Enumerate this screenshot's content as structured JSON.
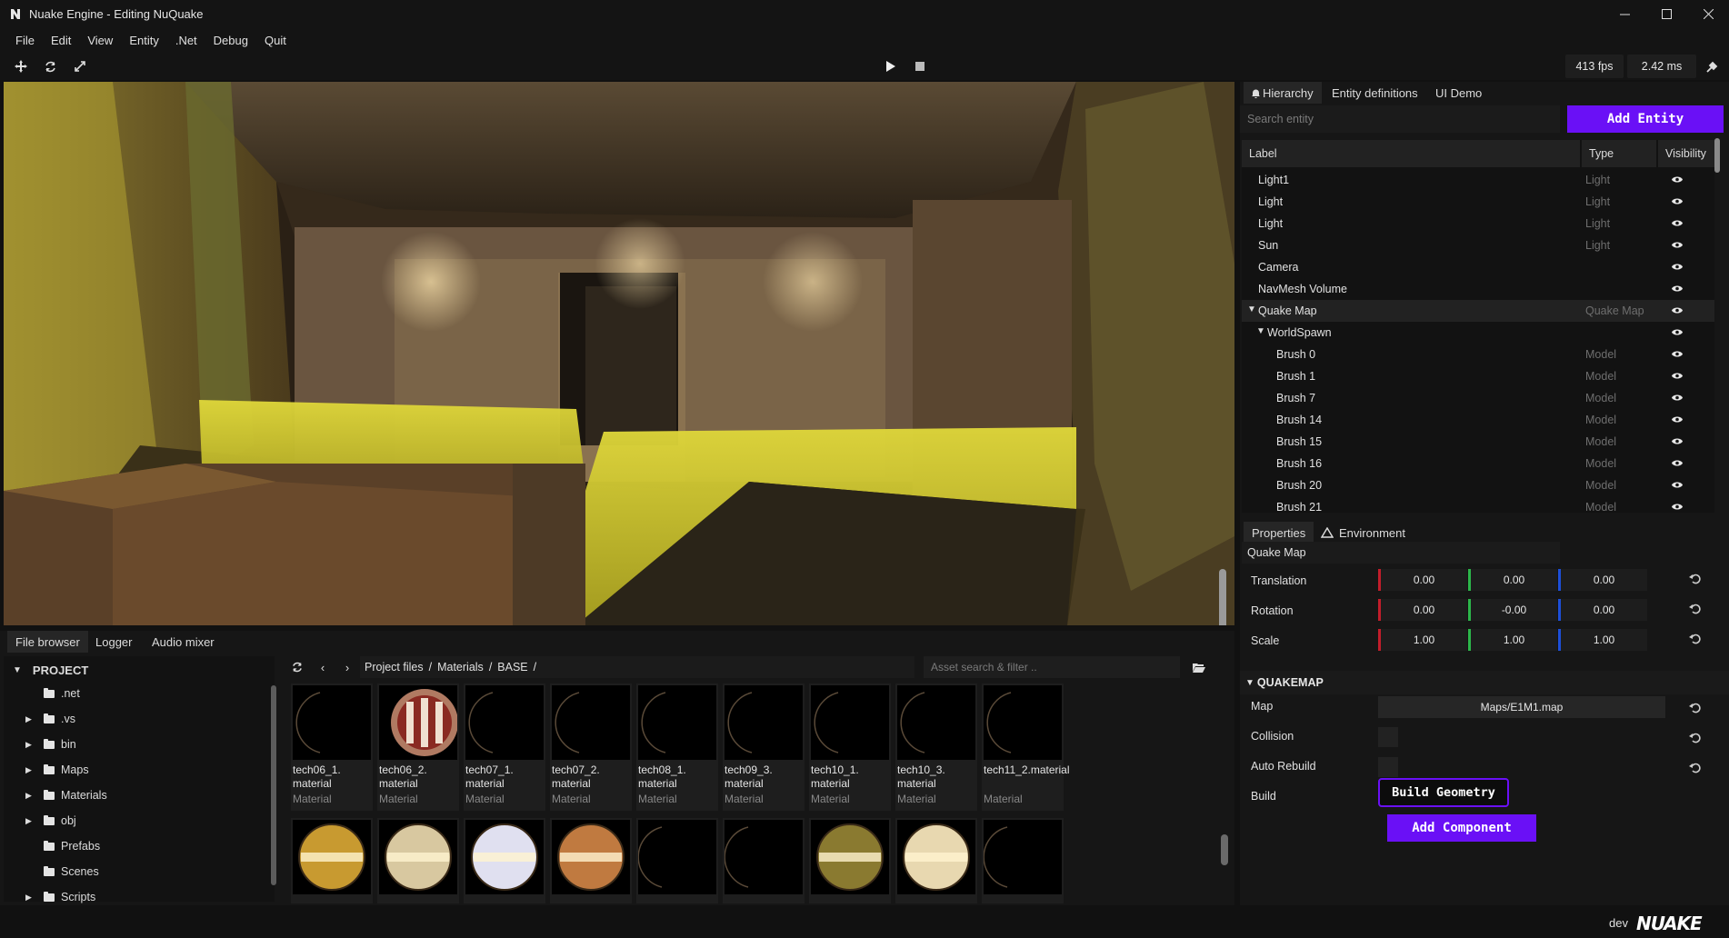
{
  "window": {
    "title": "Nuake Engine - Editing NuQuake"
  },
  "menu": {
    "items": [
      "File",
      "Edit",
      "View",
      "Entity",
      ".Net",
      "Debug",
      "Quit"
    ]
  },
  "toolbar": {
    "fps": "413 fps",
    "frame_time": "2.42 ms"
  },
  "bottom_tabs": [
    "File browser",
    "Logger",
    "Audio mixer"
  ],
  "project_tree": {
    "root": "PROJECT",
    "items": [
      ".net",
      ".vs",
      "bin",
      "Maps",
      "Materials",
      "obj",
      "Prefabs",
      "Scenes",
      "Scripts"
    ]
  },
  "file_browser": {
    "path": [
      "Project files",
      "/",
      "Materials",
      "/",
      "BASE",
      "/"
    ],
    "search_placeholder": "Asset search & filter ..",
    "assets": [
      {
        "name": "tech06_1.\nmaterial",
        "type": "Material",
        "thumb": "dark"
      },
      {
        "name": "tech06_2.\nmaterial",
        "type": "Material",
        "thumb": "red"
      },
      {
        "name": "tech07_1.\nmaterial",
        "type": "Material",
        "thumb": "dark"
      },
      {
        "name": "tech07_2.\nmaterial",
        "type": "Material",
        "thumb": "dark"
      },
      {
        "name": "tech08_1.\nmaterial",
        "type": "Material",
        "thumb": "dark"
      },
      {
        "name": "tech09_3.\nmaterial",
        "type": "Material",
        "thumb": "dark"
      },
      {
        "name": "tech10_1.\nmaterial",
        "type": "Material",
        "thumb": "dark"
      },
      {
        "name": "tech10_3.\nmaterial",
        "type": "Material",
        "thumb": "dark"
      },
      {
        "name": "tech11_2.material",
        "type": "Material",
        "thumb": "dark"
      }
    ]
  },
  "right_tabs": [
    "Hierarchy",
    "Entity definitions",
    "UI Demo"
  ],
  "hierarchy": {
    "search_placeholder": "Search entity",
    "add_entity": "Add Entity",
    "columns": [
      "Label",
      "Type",
      "Visibility"
    ],
    "rows": [
      {
        "label": "Light1",
        "type": "Light",
        "indent": 0,
        "arrow": ""
      },
      {
        "label": "Light",
        "type": "Light",
        "indent": 0,
        "arrow": ""
      },
      {
        "label": "Light",
        "type": "Light",
        "indent": 0,
        "arrow": ""
      },
      {
        "label": "Sun",
        "type": "Light",
        "indent": 0,
        "arrow": ""
      },
      {
        "label": "Camera",
        "type": "",
        "indent": 0,
        "arrow": ""
      },
      {
        "label": "NavMesh Volume",
        "type": "",
        "indent": 0,
        "arrow": ""
      },
      {
        "label": "Quake Map",
        "type": "Quake Map",
        "indent": 0,
        "arrow": "▼",
        "selected": true
      },
      {
        "label": "WorldSpawn",
        "type": "",
        "indent": 1,
        "arrow": "▼"
      },
      {
        "label": "Brush 0",
        "type": "Model",
        "indent": 2,
        "arrow": ""
      },
      {
        "label": "Brush 1",
        "type": "Model",
        "indent": 2,
        "arrow": ""
      },
      {
        "label": "Brush 7",
        "type": "Model",
        "indent": 2,
        "arrow": ""
      },
      {
        "label": "Brush 14",
        "type": "Model",
        "indent": 2,
        "arrow": ""
      },
      {
        "label": "Brush 15",
        "type": "Model",
        "indent": 2,
        "arrow": ""
      },
      {
        "label": "Brush 16",
        "type": "Model",
        "indent": 2,
        "arrow": ""
      },
      {
        "label": "Brush 20",
        "type": "Model",
        "indent": 2,
        "arrow": ""
      },
      {
        "label": "Brush 21",
        "type": "Model",
        "indent": 2,
        "arrow": ""
      }
    ]
  },
  "properties": {
    "tabs": [
      "Properties",
      "Environment"
    ],
    "entity_name": "Quake Map",
    "transform": {
      "translation_label": "Translation",
      "translation": [
        "0.00",
        "0.00",
        "0.00"
      ],
      "rotation_label": "Rotation",
      "rotation": [
        "0.00",
        "-0.00",
        "0.00"
      ],
      "scale_label": "Scale",
      "scale": [
        "1.00",
        "1.00",
        "1.00"
      ]
    },
    "quakemap": {
      "header": "QUAKEMAP",
      "map_label": "Map",
      "map_value": "Maps/E1M1.map",
      "collision_label": "Collision",
      "auto_rebuild_label": "Auto Rebuild",
      "build_label": "Build",
      "build_button": "Build Geometry"
    },
    "add_component": "Add Component"
  },
  "status": {
    "mode": "dev",
    "brand": "NUAKE"
  }
}
